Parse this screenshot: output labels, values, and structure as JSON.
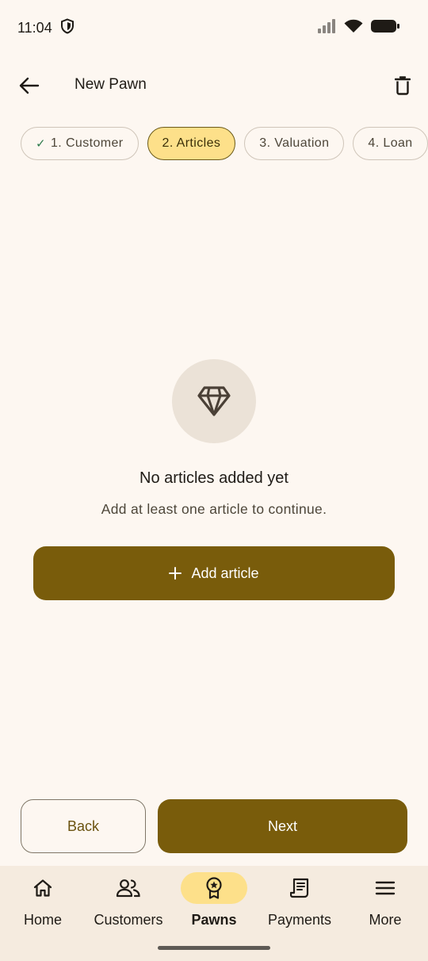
{
  "status_bar": {
    "time": "11:04"
  },
  "app_bar": {
    "title": "New Pawn"
  },
  "steps": [
    {
      "label": "1. Customer",
      "state": "done"
    },
    {
      "label": "2. Articles",
      "state": "active"
    },
    {
      "label": "3. Valuation",
      "state": "pending"
    },
    {
      "label": "4. Loan",
      "state": "pending"
    }
  ],
  "empty_state": {
    "icon": "diamond-icon",
    "title": "No articles added yet",
    "subtitle": "Add at least one article to continue."
  },
  "add_button": {
    "icon": "plus-icon",
    "label": "Add article"
  },
  "actions": {
    "back_label": "Back",
    "next_label": "Next"
  },
  "nav": {
    "items": [
      {
        "label": "Home",
        "icon": "home-icon"
      },
      {
        "label": "Customers",
        "icon": "people-icon"
      },
      {
        "label": "Pawns",
        "icon": "badge-icon",
        "active": true
      },
      {
        "label": "Payments",
        "icon": "receipt-icon"
      },
      {
        "label": "More",
        "icon": "menu-icon"
      }
    ]
  },
  "colors": {
    "background": "#fdf7f1",
    "primary": "#795c0b",
    "active_chip": "#fde08a",
    "nav_bg": "#f5ebdf"
  }
}
